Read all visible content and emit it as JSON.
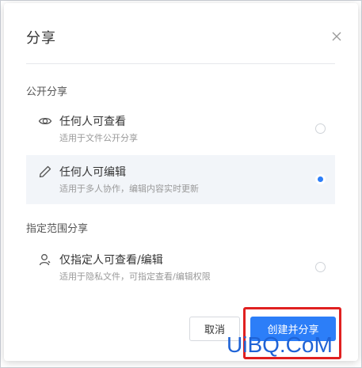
{
  "dialog": {
    "title": "分享",
    "close_icon": "close-icon"
  },
  "public_section": {
    "label": "公开分享",
    "options": [
      {
        "title": "任何人可查看",
        "desc": "适用于文件公开分享",
        "icon": "eye-icon",
        "selected": false
      },
      {
        "title": "任何人可编辑",
        "desc": "适用于多人协作，编辑内容实时更新",
        "icon": "pencil-icon",
        "selected": true
      }
    ]
  },
  "restricted_section": {
    "label": "指定范围分享",
    "options": [
      {
        "title": "仅指定人可查看/编辑",
        "desc": "适用于隐私文件，可指定查看/编辑权限",
        "icon": "user-icon",
        "selected": false
      }
    ]
  },
  "footer": {
    "cancel_label": "取消",
    "create_label": "创建并分享"
  },
  "watermark": "UiBQ.CoM",
  "colors": {
    "accent": "#2c7ef8",
    "highlight": "#e02020",
    "selected_bg": "#f2f5f9"
  }
}
